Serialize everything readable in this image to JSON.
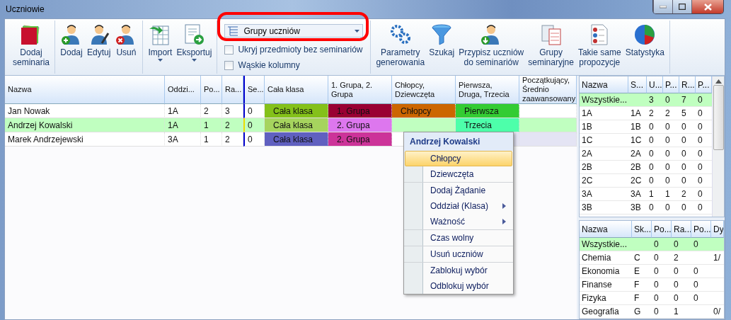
{
  "window": {
    "title": "Uczniowie"
  },
  "toolbar": {
    "groups": [
      {
        "kind": "buttons",
        "buttons": [
          {
            "label": "Dodaj\nseminaria",
            "dropdown": false
          }
        ]
      },
      {
        "kind": "buttons",
        "buttons": [
          {
            "label": "Dodaj",
            "dropdown": false
          },
          {
            "label": "Edytuj",
            "dropdown": false
          },
          {
            "label": "Usuń",
            "dropdown": false
          }
        ]
      },
      {
        "kind": "buttons",
        "buttons": [
          {
            "label": "Import",
            "dropdown": true
          },
          {
            "label": "Eksportuj",
            "dropdown": true
          }
        ]
      },
      {
        "kind": "options",
        "combo": {
          "value": "Grupy uczniów"
        },
        "checkboxes": [
          {
            "label": "Ukryj przedmioty bez seminariów",
            "checked": false
          },
          {
            "label": "Wąskie kolumny",
            "checked": false
          }
        ]
      },
      {
        "kind": "buttons",
        "buttons": [
          {
            "label": "Parametry\ngenerowania",
            "dropdown": false
          },
          {
            "label": "Szukaj",
            "dropdown": false
          },
          {
            "label": "Przypisz uczniów\ndo seminariów",
            "dropdown": false
          },
          {
            "label": "Grupy\nseminaryjne",
            "dropdown": false
          },
          {
            "label": "Takie same\npropozycje",
            "dropdown": false
          },
          {
            "label": "Statystyka",
            "dropdown": false
          }
        ]
      }
    ]
  },
  "students_grid": {
    "columns": [
      "Nazwa",
      "Oddzi...",
      "Po...",
      "Ra...",
      "Se...",
      "Cała klasa",
      "1. Grupa, 2. Grupa",
      "Chłopcy, Dziewczęta",
      "Pierwsza, Druga, Trzecia",
      "Początkujący, Średnio zaawansowany"
    ],
    "rows": [
      {
        "selected": false,
        "cells": [
          {
            "text": "Jan Nowak"
          },
          {
            "text": "1A"
          },
          {
            "text": "2"
          },
          {
            "text": "3"
          },
          {
            "text": "0"
          },
          {
            "text": "Cała klasa",
            "color": "#84c11a"
          },
          {
            "text": "1. Grupa",
            "color": "#990033"
          },
          {
            "text": "Chłopcy",
            "color": "#cc6600"
          },
          {
            "text": "Pierwsza",
            "color": "#33cc33"
          },
          {}
        ]
      },
      {
        "selected": true,
        "cells": [
          {
            "text": "Andrzej Kowalski"
          },
          {
            "text": "1A"
          },
          {
            "text": "1"
          },
          {
            "text": "2"
          },
          {
            "text": "0"
          },
          {
            "text": "Cała klasa",
            "color": "#a6d45e"
          },
          {
            "text": "2. Grupa",
            "color": "#dd77ee"
          },
          {},
          {
            "text": "Trzecia",
            "color": "#4dffaa"
          },
          {}
        ]
      },
      {
        "selected": false,
        "cells": [
          {
            "text": "Marek Andrzejewski"
          },
          {
            "text": "3A"
          },
          {
            "text": "1"
          },
          {
            "text": "2"
          },
          {
            "text": "0"
          },
          {
            "text": "Cała klasa",
            "color": "#6060c0"
          },
          {
            "text": "2. Grupa",
            "color": "#cc3399"
          },
          {},
          {
            "color": "#e4e4f4"
          },
          {
            "color": "#e4e4f4"
          }
        ]
      }
    ]
  },
  "context_menu": {
    "title": "Andrzej Kowalski",
    "groups": [
      [
        {
          "label": "Chłopcy",
          "selected": true,
          "submenu": false
        },
        {
          "label": "Dziewczęta",
          "selected": false,
          "submenu": false
        }
      ],
      [
        {
          "label": "Dodaj Żądanie",
          "selected": false,
          "submenu": false
        },
        {
          "label": "Oddział (Klasa)",
          "selected": false,
          "submenu": true
        },
        {
          "label": "Ważność",
          "selected": false,
          "submenu": true
        }
      ],
      [
        {
          "label": "Czas wolny",
          "selected": false,
          "submenu": false
        }
      ],
      [
        {
          "label": "Usuń uczniów",
          "selected": false,
          "submenu": false
        }
      ],
      [
        {
          "label": "Zablokuj wybór",
          "selected": false,
          "submenu": false
        },
        {
          "label": "Odblokuj wybór",
          "selected": false,
          "submenu": false
        }
      ]
    ]
  },
  "classes_table": {
    "columns": [
      "Nazwa",
      "S...",
      "U...",
      "P...",
      "R...",
      "P..."
    ],
    "rows": [
      {
        "selected": true,
        "cells": [
          "Wszystkie...",
          null,
          "3",
          "0",
          "7",
          "0"
        ]
      },
      {
        "selected": false,
        "cells": [
          "1A",
          "1A",
          "2",
          "2",
          "5",
          "0"
        ]
      },
      {
        "selected": false,
        "cells": [
          "1B",
          "1B",
          "0",
          "0",
          "0",
          "0"
        ]
      },
      {
        "selected": false,
        "cells": [
          "1C",
          "1C",
          "0",
          "0",
          "0",
          "0"
        ]
      },
      {
        "selected": false,
        "cells": [
          "2A",
          "2A",
          "0",
          "0",
          "0",
          "0"
        ]
      },
      {
        "selected": false,
        "cells": [
          "2B",
          "2B",
          "0",
          "0",
          "0",
          "0"
        ]
      },
      {
        "selected": false,
        "cells": [
          "2C",
          "2C",
          "0",
          "0",
          "0",
          "0"
        ]
      },
      {
        "selected": false,
        "cells": [
          "3A",
          "3A",
          "1",
          "1",
          "2",
          "0"
        ]
      },
      {
        "selected": false,
        "cells": [
          "3B",
          "3B",
          "0",
          "0",
          "0",
          "0"
        ]
      }
    ]
  },
  "subjects_table": {
    "columns": [
      "Nazwa",
      "Sk...",
      "Po...",
      "Ra...",
      "Po...",
      "Dy"
    ],
    "rows": [
      {
        "selected": true,
        "cells": [
          "Wszystkie...",
          null,
          "0",
          "0",
          "0",
          null
        ]
      },
      {
        "selected": false,
        "cells": [
          "Chemia",
          "C",
          "0",
          "2",
          null,
          "1/"
        ]
      },
      {
        "selected": false,
        "cells": [
          "Ekonomia",
          "E",
          "0",
          "0",
          "0",
          null
        ]
      },
      {
        "selected": false,
        "cells": [
          "Finanse",
          "F",
          "0",
          "0",
          "0",
          null
        ]
      },
      {
        "selected": false,
        "cells": [
          "Fizyka",
          "F",
          "0",
          "0",
          "0",
          null
        ]
      },
      {
        "selected": false,
        "cells": [
          "Geografia",
          "G",
          "0",
          "1",
          null,
          "0/"
        ]
      }
    ]
  }
}
